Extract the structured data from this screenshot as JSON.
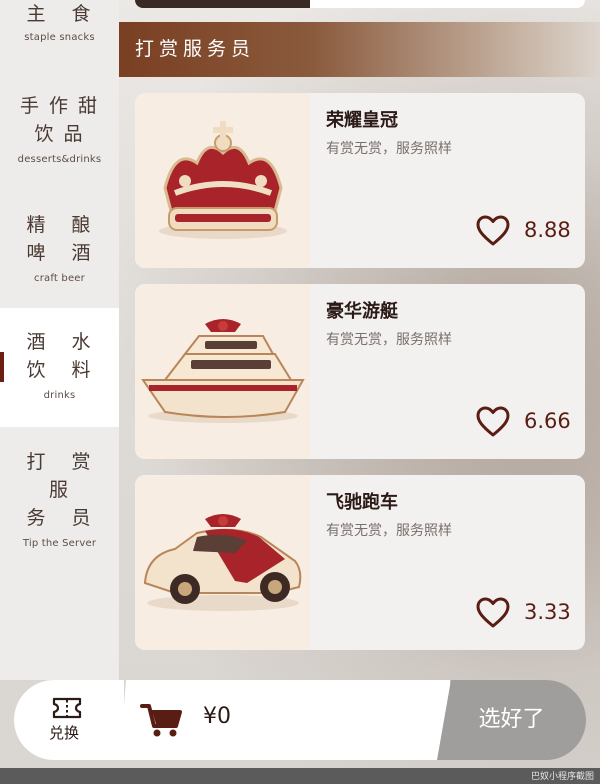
{
  "sidebar": {
    "items": [
      {
        "zh": "主 食",
        "en": "staple snacks"
      },
      {
        "zh": "手作甜\n饮品",
        "en": "desserts&drinks"
      },
      {
        "zh": "精 酿\n啤 酒",
        "en": "craft beer"
      },
      {
        "zh": "酒 水\n饮 料",
        "en": "drinks",
        "active": true
      },
      {
        "zh": "打 赏 服\n务 员",
        "en": "Tip the Server"
      }
    ]
  },
  "section": {
    "title": "打赏服务员"
  },
  "products": [
    {
      "name": "荣耀皇冠",
      "desc": "有赏无赏，服务照样",
      "price": "8.88",
      "icon": "crown-image"
    },
    {
      "name": "豪华游艇",
      "desc": "有赏无赏，服务照样",
      "price": "6.66",
      "icon": "yacht-image"
    },
    {
      "name": "飞驰跑车",
      "desc": "有赏无赏，服务照样",
      "price": "3.33",
      "icon": "sports-car-image"
    }
  ],
  "bottom_bar": {
    "redeem_label": "兑换",
    "total": "¥0",
    "confirm_label": "选好了"
  },
  "watermark": "巴奴小程序截图",
  "colors": {
    "accent": "#6b1e14",
    "price": "#5a1d14",
    "header_start": "#7a3f22",
    "confirm_bg": "#a09e9c"
  }
}
